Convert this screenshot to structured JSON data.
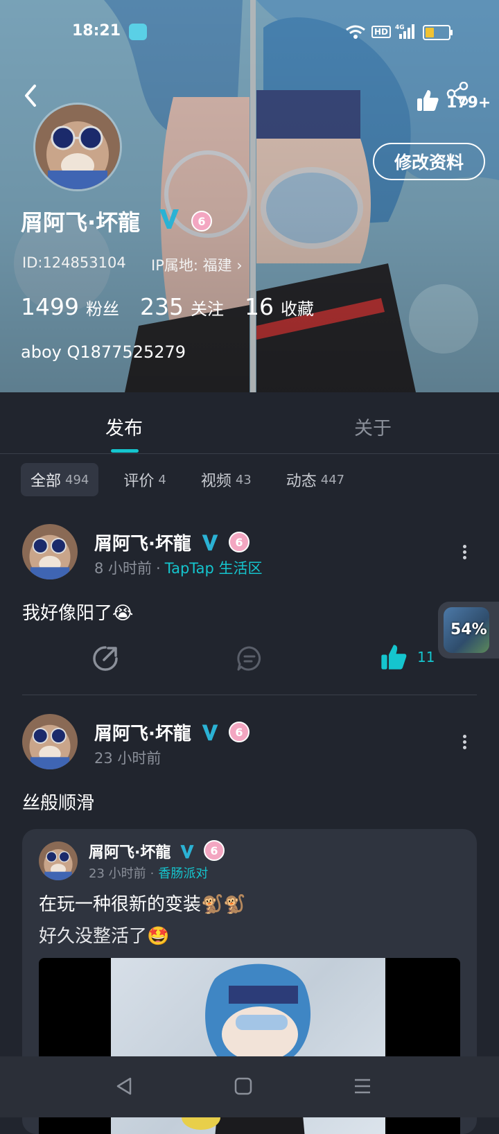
{
  "status_bar": {
    "time": "18:21",
    "hd": "HD",
    "network": "4G"
  },
  "header": {
    "share_count": "179+",
    "edit_button": "修改资料",
    "name": "屑阿飞·坏龍",
    "level": "6",
    "id_text": "ID:124853104",
    "ip_text": "IP属地: 福建",
    "stats": [
      {
        "num": "1499",
        "label": "粉丝"
      },
      {
        "num": "235",
        "label": "关注"
      },
      {
        "num": "16",
        "label": "收藏"
      }
    ],
    "bio": "aboy Q1877525279"
  },
  "tabs": {
    "publish": "发布",
    "about": "关于"
  },
  "filters": [
    {
      "label": "全部",
      "count": "494",
      "active": true
    },
    {
      "label": "评价",
      "count": "4",
      "active": false
    },
    {
      "label": "视频",
      "count": "43",
      "active": false
    },
    {
      "label": "动态",
      "count": "447",
      "active": false
    }
  ],
  "posts": [
    {
      "name": "屑阿飞·坏龍",
      "level": "6",
      "time": "8 小时前",
      "separator": "·",
      "forum": "TapTap 生活区",
      "text": "我好像阳了😭",
      "like_count": "11"
    },
    {
      "name": "屑阿飞·坏龍",
      "level": "6",
      "time": "23 小时前",
      "text": "丝般顺滑"
    }
  ],
  "repost": {
    "name": "屑阿飞·坏龍",
    "level": "6",
    "time": "23 小时前",
    "separator": "·",
    "forum": "香肠派对",
    "line1": "在玩一种很新的变装🐒🐒",
    "line2": "好久没整活了🤩"
  },
  "floating": {
    "percent": "54%"
  },
  "colors": {
    "accent": "#15c5ce",
    "background": "#21252e",
    "verified": "#2bb2d4",
    "level_badge": "#f3a6c1"
  }
}
